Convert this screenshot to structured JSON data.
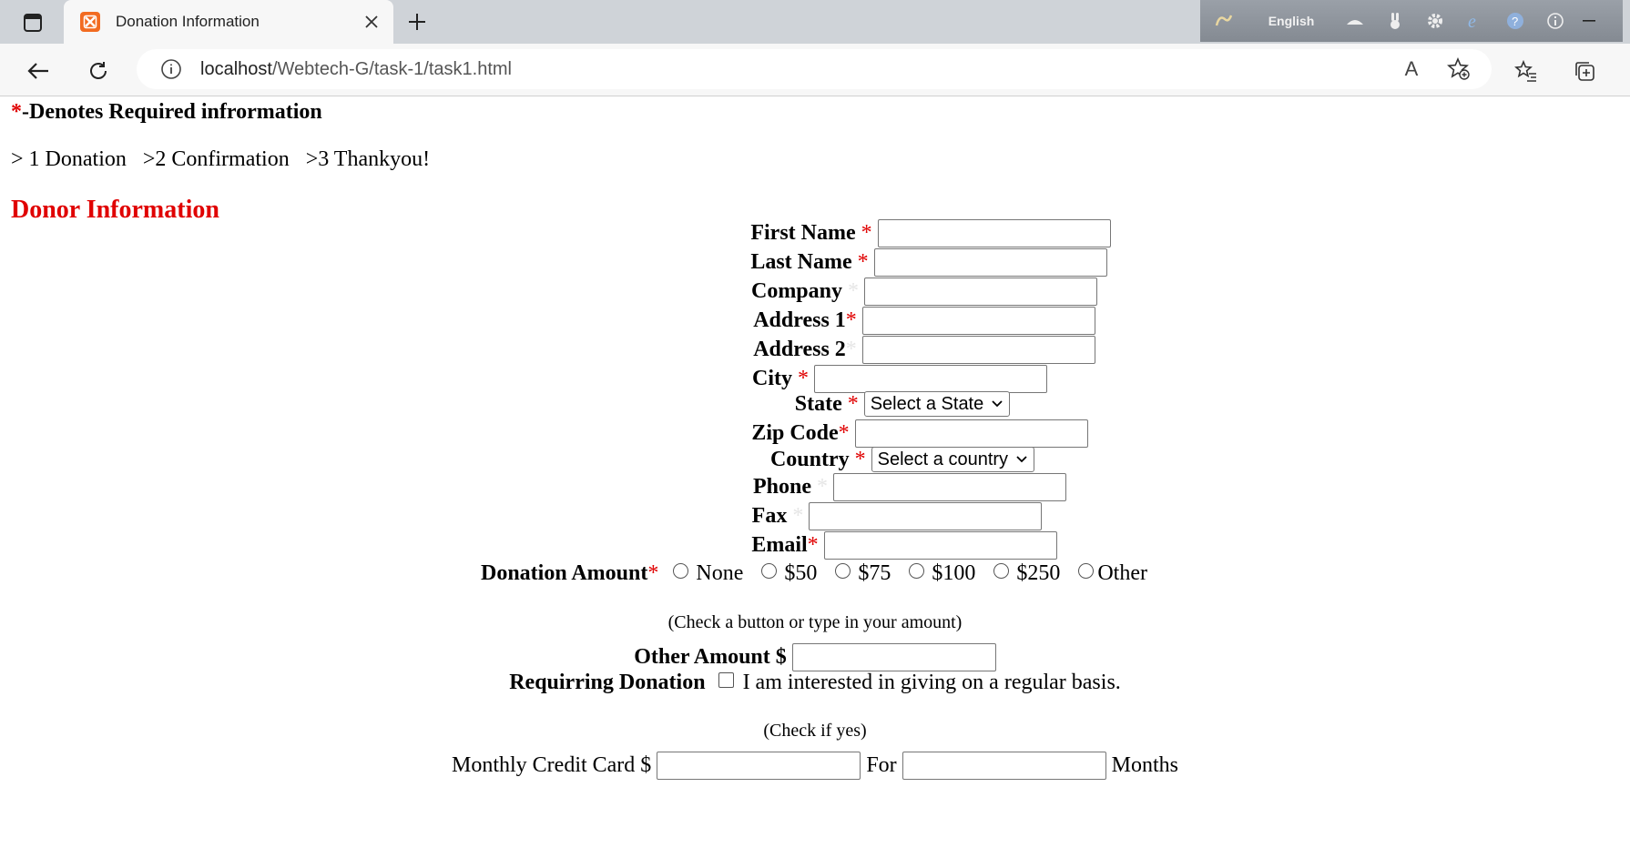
{
  "browser": {
    "tab_title": "Donation Information",
    "url_host": "localhost",
    "url_path": "/Webtech-G/task-1/task1.html",
    "ime_language": "English",
    "read_aloud_label": "A"
  },
  "page": {
    "required_star": "*",
    "required_note": "-Denotes Required infrormation",
    "steps": "> 1 Donation   >2 Confirmation   >3 Thankyou!",
    "heading": "Donor Information"
  },
  "form": {
    "first_name": {
      "label": "First Name ",
      "star": "*"
    },
    "last_name": {
      "label": "Last Name ",
      "star": "*"
    },
    "company": {
      "label": "Company ",
      "star": "*"
    },
    "address1": {
      "label": "Address 1",
      "star": "*"
    },
    "address2": {
      "label": "Address 2",
      "star": "*"
    },
    "city": {
      "label": "City ",
      "star": "*"
    },
    "state": {
      "label": "State ",
      "star": "*",
      "selected": "Select a State"
    },
    "zip": {
      "label": "Zip Code",
      "star": "*"
    },
    "country": {
      "label": "Country ",
      "star": "*",
      "selected": "Select a country"
    },
    "phone": {
      "label": "Phone ",
      "star": "*"
    },
    "fax": {
      "label": "Fax ",
      "star": "*"
    },
    "email": {
      "label": "Email",
      "star": "*"
    },
    "donation": {
      "label": "Donation Amount",
      "star": "*",
      "options": [
        "None",
        "$50",
        "$75",
        "$100",
        "$250",
        "Other"
      ]
    },
    "donation_note": "(Check a button or type in your amount)",
    "other_amount": {
      "label": "Other Amount $"
    },
    "recurring": {
      "label": "Requirring Donation",
      "checkbox_text": "I am interested in giving on a regular basis."
    },
    "recurring_note": "(Check if yes)",
    "monthly": {
      "label": "Monthly Credit Card $",
      "for_label": "For",
      "months_label": "Months"
    }
  },
  "colors": {
    "required": "#e00000",
    "faint_star": "#e6e6e6",
    "tabstrip": "#cfd3d8",
    "favicon": "#f26b21"
  }
}
